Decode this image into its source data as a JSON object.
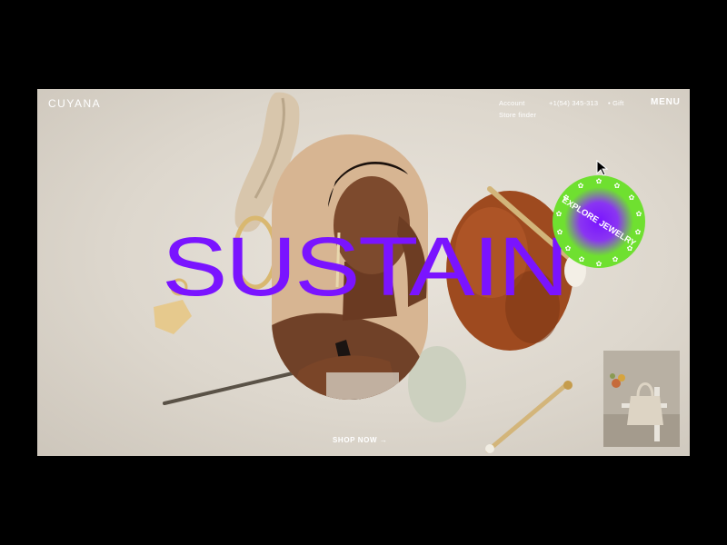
{
  "brand": {
    "logo": "CUYANA"
  },
  "header": {
    "account": "Account",
    "store_finder": "Store finder",
    "phone": "+1(54) 345-313",
    "gift": "• Gift",
    "menu": "MENU"
  },
  "hero": {
    "headline": "SUSTAIN",
    "badge_text": "EXPLORE JEWELRY",
    "cta": "SHOP NOW →"
  },
  "colors": {
    "accent": "#7a14ff",
    "badge_green": "#6fe030",
    "background": "#e3ded6",
    "frame": "#000000"
  },
  "icons": [
    "cursor-icon",
    "flower-icon"
  ]
}
